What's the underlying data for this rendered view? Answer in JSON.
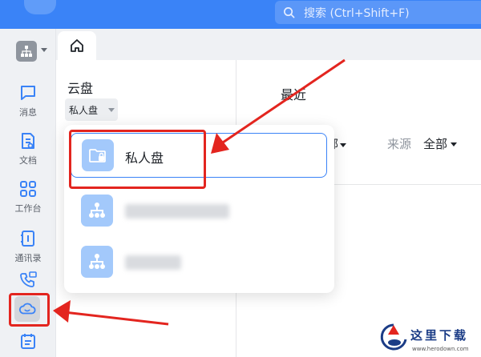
{
  "search": {
    "placeholder": "搜索 (Ctrl+Shift+F)"
  },
  "rail": {
    "items": [
      {
        "label": "消息",
        "icon": "message-icon"
      },
      {
        "label": "文档",
        "icon": "document-icon"
      },
      {
        "label": "工作台",
        "icon": "workspace-icon"
      },
      {
        "label": "通讯录",
        "icon": "contacts-icon"
      }
    ],
    "extra_icons": [
      "phone-icon",
      "cloud-drive-icon",
      "calendar-icon"
    ]
  },
  "panel": {
    "title": "云盘",
    "space_selected": "私人盘"
  },
  "main": {
    "title": "最近",
    "filter_value_fragment": "部",
    "source_label": "来源",
    "source_value": "全部"
  },
  "dropdown": {
    "items": [
      {
        "label": "私人盘",
        "icon": "private-folder-lock-icon",
        "selected": true
      },
      {
        "label": "",
        "icon": "org-chart-icon",
        "selected": false
      },
      {
        "label": "",
        "icon": "org-chart-icon",
        "selected": false
      }
    ]
  },
  "colors": {
    "accent": "#3a83f7",
    "annotation_red": "#e3251f",
    "rail_bg": "#eff1f4",
    "icon_tile": "#a3c9fb"
  },
  "watermark": {
    "title": "这里下载",
    "url": "www.herodown.com"
  }
}
